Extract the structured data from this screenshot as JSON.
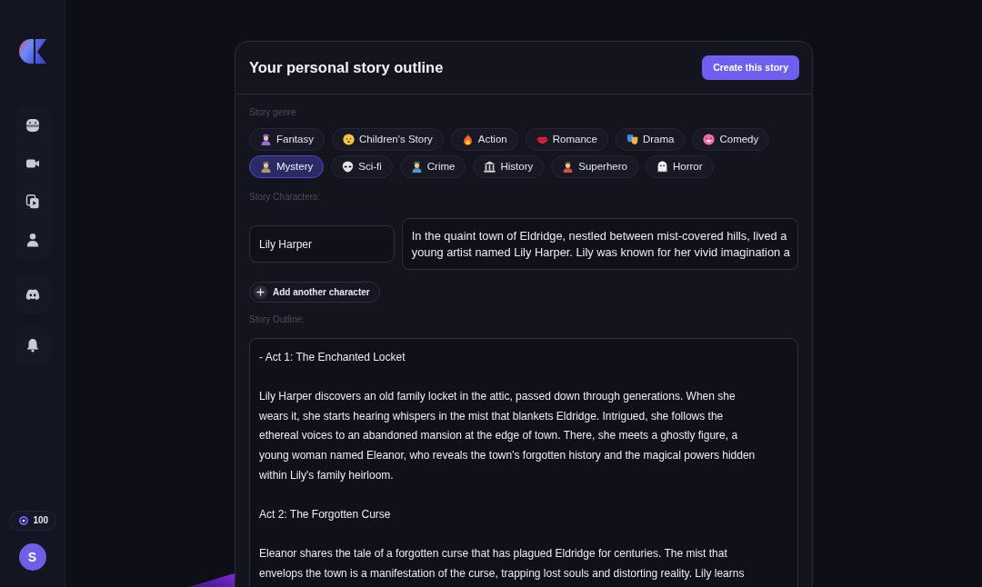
{
  "sidebar": {
    "credits": "100",
    "avatar_initial": "S"
  },
  "header": {
    "title": "Your personal story outline",
    "create_button": "Create this story"
  },
  "genre_section": {
    "label": "Story genre",
    "genres": [
      {
        "label": "Fantasy",
        "selected": false
      },
      {
        "label": "Children's Story",
        "selected": false
      },
      {
        "label": "Action",
        "selected": false
      },
      {
        "label": "Romance",
        "selected": false
      },
      {
        "label": "Drama",
        "selected": false
      },
      {
        "label": "Comedy",
        "selected": false
      },
      {
        "label": "Mystery",
        "selected": true
      },
      {
        "label": "Sci-fi",
        "selected": false
      },
      {
        "label": "Crime",
        "selected": false
      },
      {
        "label": "History",
        "selected": false
      },
      {
        "label": "Superhero",
        "selected": false
      },
      {
        "label": "Horror",
        "selected": false
      }
    ]
  },
  "characters_section": {
    "label": "Story Characters:",
    "characters": [
      {
        "name": "Lily Harper",
        "description": "In the quaint town of Eldridge, nestled between mist-covered hills, lived a young artist named Lily Harper. Lily was known for her vivid imagination a"
      }
    ],
    "add_button": "Add another character"
  },
  "outline_section": {
    "label": "Story Outline:",
    "paragraphs": [
      "- Act 1: The Enchanted Locket",
      "Lily Harper discovers an old family locket in the attic, passed down through generations. When she wears it, she starts hearing whispers in the mist that blankets Eldridge. Intrigued, she follows the ethereal voices to an abandoned mansion at the edge of town. There, she meets a ghostly figure, a young woman named Eleanor, who reveals the town's forgotten history and the magical powers hidden within Lily's family heirloom.",
      "Act 2: The Forgotten Curse",
      "Eleanor shares the tale of a forgotten curse that has plagued Eldridge for centuries. The mist that envelops the town is a manifestation of the curse, trapping lost souls and distorting reality. Lily learns"
    ]
  }
}
